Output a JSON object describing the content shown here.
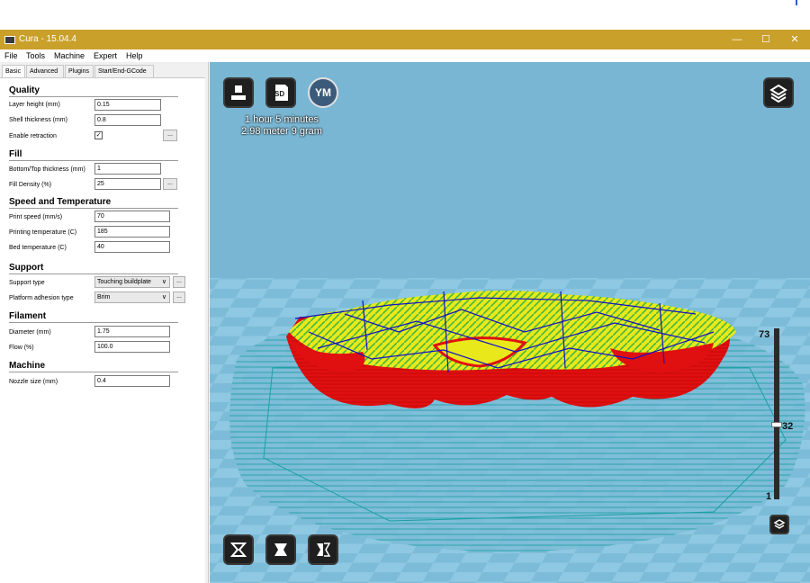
{
  "window": {
    "title": "Cura - 15.04.4",
    "minimize_glyph": "—",
    "maximize_glyph": "☐",
    "close_glyph": "✕"
  },
  "menu": [
    "File",
    "Tools",
    "Machine",
    "Expert",
    "Help"
  ],
  "tabs": [
    "Basic",
    "Advanced",
    "Plugins",
    "Start/End-GCode"
  ],
  "settings": {
    "quality": {
      "title": "Quality",
      "layer_height_label": "Layer height (mm)",
      "layer_height": "0.15",
      "shell_thickness_label": "Shell thickness (mm)",
      "shell_thickness": "0.8",
      "enable_retraction_label": "Enable retraction",
      "enable_retraction_check": "✓"
    },
    "fill": {
      "title": "Fill",
      "bottom_top_label": "Bottom/Top thickness (mm)",
      "bottom_top": "1",
      "fill_density_label": "Fill Density (%)",
      "fill_density": "25"
    },
    "speed": {
      "title": "Speed and Temperature",
      "print_speed_label": "Print speed (mm/s)",
      "print_speed": "70",
      "printing_temp_label": "Printing temperature (C)",
      "printing_temp": "185",
      "bed_temp_label": "Bed temperature (C)",
      "bed_temp": "40"
    },
    "support": {
      "title": "Support",
      "support_type_label": "Support type",
      "support_type": "Touching buildplate",
      "adhesion_label": "Platform adhesion type",
      "adhesion": "Brim"
    },
    "filament": {
      "title": "Filament",
      "diameter_label": "Diameter (mm)",
      "diameter": "1.75",
      "flow_label": "Flow (%)",
      "flow": "100.0"
    },
    "machine": {
      "title": "Machine",
      "nozzle_label": "Nozzle size (mm)",
      "nozzle": "0.4"
    },
    "more_button": "...",
    "dropdown_arrow": "∨"
  },
  "viewport": {
    "print_time": "1 hour 5 minutes",
    "print_material": "2.98 meter 9 gram",
    "sd_label": "SD",
    "ym_label": "YM",
    "layer_top": "73",
    "layer_current": "32",
    "layer_bottom": "1",
    "layer_total": 73,
    "layer_current_value": 32
  },
  "colors": {
    "titlebar": "#c9a02a",
    "viewport_bg": "#7cbad6",
    "outer_wall": "#e01010",
    "infill": "#e8e81a",
    "support": "#3fbf3f",
    "travel": "#1010c8",
    "brim": "#1aa0a0"
  },
  "icons": [
    "load-model-icon",
    "sd-card-icon",
    "youmagine-icon",
    "view-mode-icon",
    "rotate-icon",
    "scale-icon",
    "mirror-icon",
    "layer-view-icon"
  ]
}
